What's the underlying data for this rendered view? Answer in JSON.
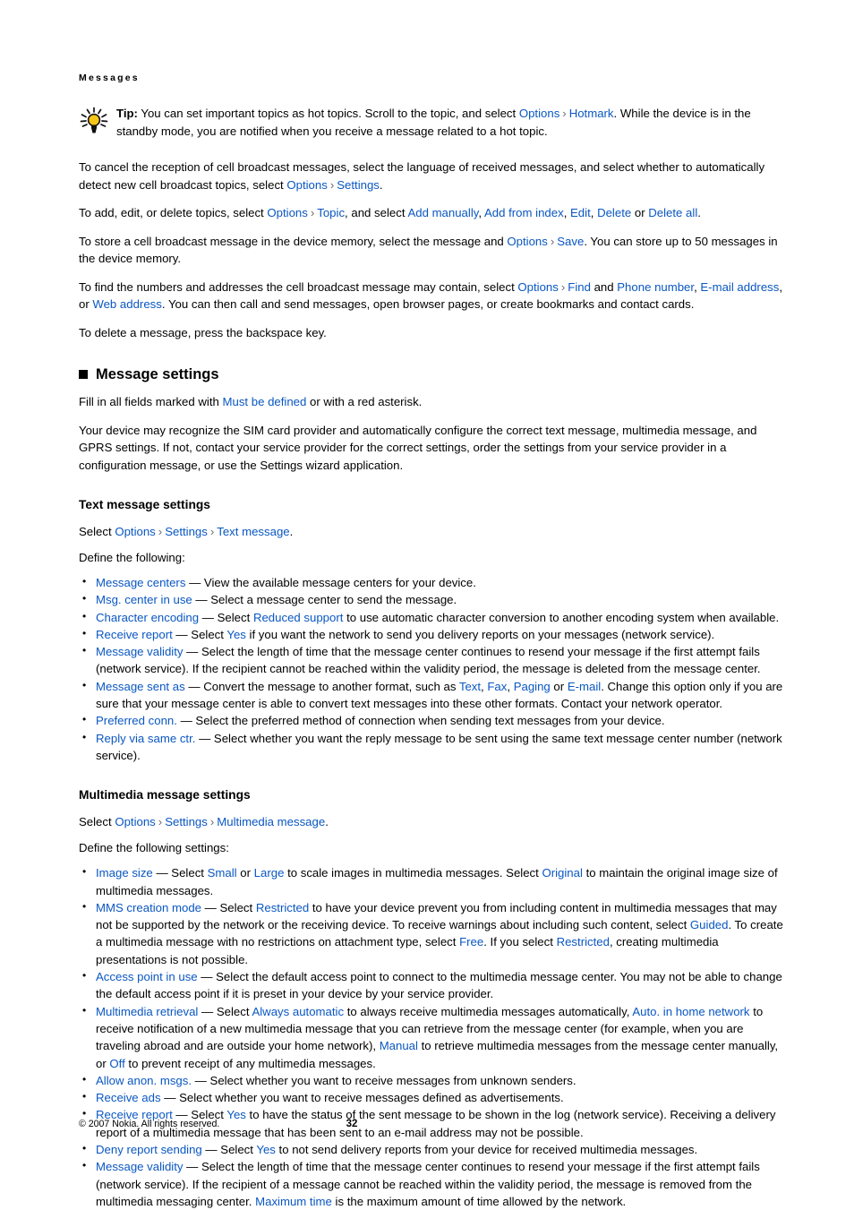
{
  "running_head": "Messages",
  "tip": {
    "icon": "lightbulb-icon",
    "label": "Tip:",
    "text_1": " You can set important topics as hot topics. Scroll to the topic, and select ",
    "link_options": "Options",
    "separator": "›",
    "link_hotmark": "Hotmark",
    "text_2": ". While the device is in the standby mode, you are notified when you receive a message related to a hot topic."
  },
  "intro_paragraphs": {
    "p1_a": "To cancel the reception of cell broadcast messages, select the language of received messages, and select whether to automatically detect new cell broadcast topics, select ",
    "p1_options": "Options",
    "p1_settings": "Settings",
    "p1_b": ".",
    "p2_a": "To add, edit, or delete topics, select ",
    "p2_options": "Options",
    "p2_topic": "Topic",
    "p2_b": ", and select ",
    "p2_add_manually": "Add manually",
    "p2_add_from_index": "Add from index",
    "p2_edit": "Edit",
    "p2_delete": "Delete",
    "p2_or": " or ",
    "p2_delete_all": "Delete all",
    "p2_c": ".",
    "p3_a": "To store a cell broadcast message in the device memory, select the message and ",
    "p3_options": "Options",
    "p3_save": "Save",
    "p3_b": ". You can store up to 50 messages in the device memory.",
    "p4_a": "To find the numbers and addresses the cell broadcast message may contain, select ",
    "p4_options": "Options",
    "p4_find": "Find",
    "p4_and": " and ",
    "p4_phone_number": "Phone number",
    "p4_email_address": "E-mail address",
    "p4_comma_or": ", or ",
    "p4_web_address": "Web address",
    "p4_b": ". You can then call and send messages, open browser pages, or create bookmarks and contact cards.",
    "p5": "To delete a message, press the backspace key."
  },
  "message_settings": {
    "heading": "Message settings",
    "fill_in_a": "Fill in all fields marked with ",
    "fill_in_link": "Must be defined",
    "fill_in_b": " or with a red asterisk.",
    "device_para": "Your device may recognize the SIM card provider and automatically configure the correct text message, multimedia message, and GPRS settings. If not, contact your service provider for the correct settings, order the settings from your service provider in a configuration message, or use the Settings wizard application."
  },
  "text_message_settings": {
    "heading": "Text message settings",
    "select_prefix": "Select ",
    "select_options": "Options",
    "select_settings": "Settings",
    "select_text_message": "Text message",
    "select_suffix": ".",
    "define_line": "Define the following:",
    "items": [
      {
        "term": "Message centers",
        "desc_a": " — View the available message centers for your device."
      },
      {
        "term": "Msg. center in use",
        "desc_a": " — Select a message center to send the message."
      },
      {
        "term": "Character encoding",
        "desc_a": " — Select ",
        "link_1": "Reduced support",
        "desc_b": " to use automatic character conversion to another encoding system when available."
      },
      {
        "term": "Receive report",
        "desc_a": " — Select ",
        "link_1": "Yes",
        "desc_b": " if you want the network to send you delivery reports on your messages (network service)."
      },
      {
        "term": "Message validity",
        "desc_a": " — Select the length of time that the message center continues to resend your message if the first attempt fails (network service). If the recipient cannot be reached within the validity period, the message is deleted from the message center."
      },
      {
        "term": "Message sent as",
        "desc_a": " — Convert the message to another format, such as ",
        "link_1": "Text",
        "sep_1": ", ",
        "link_2": "Fax",
        "sep_2": ", ",
        "link_3": "Paging",
        "sep_3": " or ",
        "link_4": "E-mail",
        "desc_b": ". Change this option only if you are sure that your message center is able to convert text messages into these other formats. Contact your network operator."
      },
      {
        "term": "Preferred conn.",
        "desc_a": " — Select the preferred method of connection when sending text messages from your device."
      },
      {
        "term": "Reply via same ctr.",
        "desc_a": " — Select whether you want the reply message to be sent using the same text message center number (network service)."
      }
    ]
  },
  "multimedia_message_settings": {
    "heading": "Multimedia message settings",
    "select_prefix": "Select ",
    "select_options": "Options",
    "select_settings": "Settings",
    "select_multimedia_message": "Multimedia message",
    "select_suffix": ".",
    "define_line": "Define the following settings:",
    "items": [
      {
        "term": "Image size",
        "desc_a": " — Select ",
        "link_1": "Small",
        "sep_1": " or ",
        "link_2": "Large",
        "desc_b": " to scale images in multimedia messages. Select ",
        "link_3": "Original",
        "desc_c": " to maintain the original image size of multimedia messages."
      },
      {
        "term": "MMS creation mode",
        "desc_a": " — Select ",
        "link_1": "Restricted",
        "desc_b": " to have your device prevent you from including content in multimedia messages that may not be supported by the network or the receiving device. To receive warnings about including such content, select ",
        "link_2": "Guided",
        "desc_c": ". To create a multimedia message with no restrictions on attachment type, select ",
        "link_3": "Free",
        "desc_d": ". If you select ",
        "link_4": "Restricted",
        "desc_e": ", creating multimedia presentations is not possible."
      },
      {
        "term": "Access point in use",
        "desc_a": " — Select the default access point to connect to the multimedia message center. You may not be able to change the default access point if it is preset in your device by your service provider."
      },
      {
        "term": "Multimedia retrieval",
        "desc_a": " — Select ",
        "link_1": "Always automatic",
        "desc_b": " to always receive multimedia messages automatically, ",
        "link_2": "Auto. in home network",
        "desc_c": " to receive notification of a new multimedia message that you can retrieve from the message center (for example, when you are traveling abroad and are outside your home network), ",
        "link_3": "Manual",
        "desc_d": " to retrieve multimedia messages from the message center manually, or ",
        "link_4": "Off",
        "desc_e": " to prevent receipt of any multimedia messages."
      },
      {
        "term": "Allow anon. msgs.",
        "desc_a": " — Select whether you want to receive messages from unknown senders."
      },
      {
        "term": "Receive ads",
        "desc_a": " — Select whether you want to receive messages defined as advertisements."
      },
      {
        "term": "Receive report",
        "desc_a": " — Select ",
        "link_1": "Yes",
        "desc_b": " to have the status of the sent message to be shown in the log (network service). Receiving a delivery report of a multimedia message that has been sent to an e-mail address may not be possible."
      },
      {
        "term": "Deny report sending",
        "desc_a": " — Select ",
        "link_1": "Yes",
        "desc_b": " to not send delivery reports from your device for received multimedia messages."
      },
      {
        "term": "Message validity",
        "desc_a": " — Select the length of time that the message center continues to resend your message if the first attempt fails (network service). If the recipient of a message cannot be reached within the validity period, the message is removed from the multimedia messaging center. ",
        "link_1": "Maximum time",
        "desc_b": " is the maximum amount of time allowed by the network."
      }
    ]
  },
  "footer": {
    "copyright": "© 2007 Nokia. All rights reserved.",
    "page_number": "32"
  },
  "colors": {
    "link_blue": "#0a57c2",
    "separator_gray": "#6d6d6d",
    "text_black": "#000000"
  }
}
